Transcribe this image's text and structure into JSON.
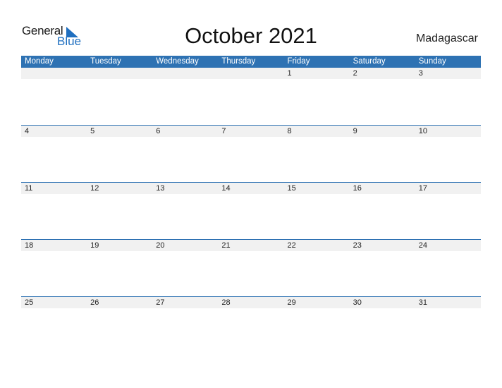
{
  "logo": {
    "general": "General",
    "blue": "Blue"
  },
  "title": "October 2021",
  "country": "Madagascar",
  "days": [
    "Monday",
    "Tuesday",
    "Wednesday",
    "Thursday",
    "Friday",
    "Saturday",
    "Sunday"
  ],
  "weeks": [
    [
      "",
      "",
      "",
      "",
      "1",
      "2",
      "3"
    ],
    [
      "4",
      "5",
      "6",
      "7",
      "8",
      "9",
      "10"
    ],
    [
      "11",
      "12",
      "13",
      "14",
      "15",
      "16",
      "17"
    ],
    [
      "18",
      "19",
      "20",
      "21",
      "22",
      "23",
      "24"
    ],
    [
      "25",
      "26",
      "27",
      "28",
      "29",
      "30",
      "31"
    ]
  ],
  "colors": {
    "accent": "#2e72b3",
    "row_band": "#f1f1f1",
    "logo_blue": "#1f6fc0"
  }
}
